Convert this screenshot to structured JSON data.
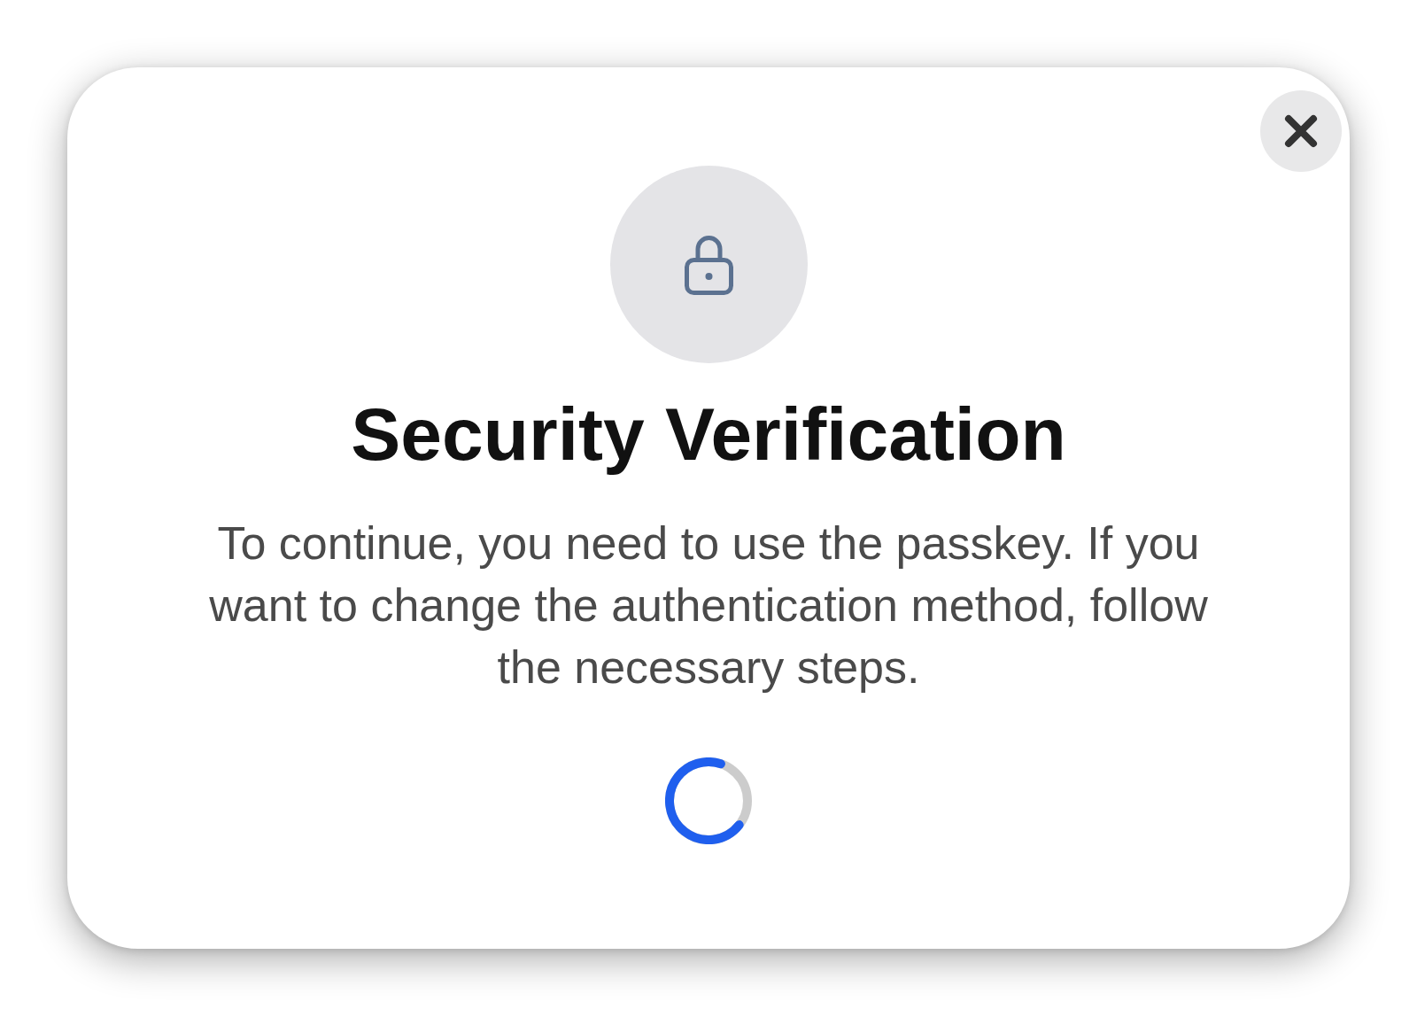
{
  "dialog": {
    "title": "Security Verification",
    "message": "To continue, you need to use the passkey. If you want to change the authentication method, follow the necessary steps.",
    "loading": true
  }
}
